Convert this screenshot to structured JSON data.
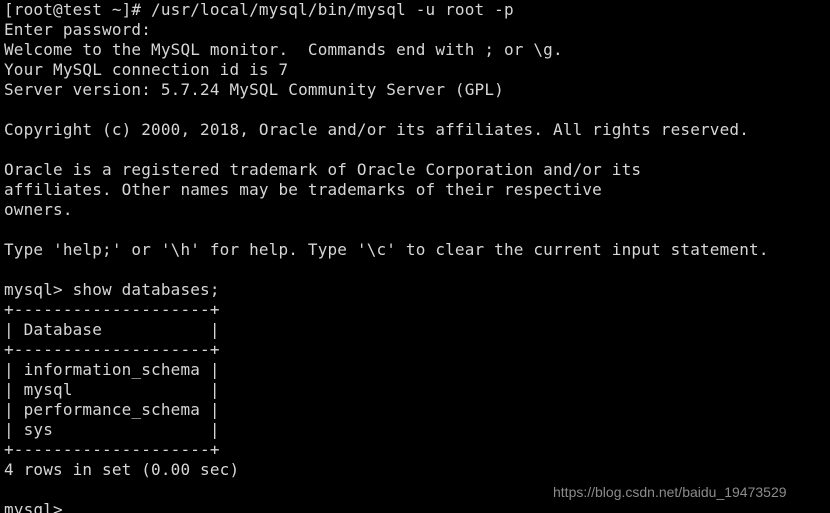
{
  "terminal": {
    "background_color": "#000000",
    "text_color": "#d6d6d6",
    "lines": [
      "[root@test ~]# /usr/local/mysql/bin/mysql -u root -p",
      "Enter password:",
      "Welcome to the MySQL monitor.  Commands end with ; or \\g.",
      "Your MySQL connection id is 7",
      "Server version: 5.7.24 MySQL Community Server (GPL)",
      "",
      "Copyright (c) 2000, 2018, Oracle and/or its affiliates. All rights reserved.",
      "",
      "Oracle is a registered trademark of Oracle Corporation and/or its",
      "affiliates. Other names may be trademarks of their respective",
      "owners.",
      "",
      "Type 'help;' or '\\h' for help. Type '\\c' to clear the current input statement.",
      "",
      "mysql> show databases;",
      "+--------------------+",
      "| Database           |",
      "+--------------------+",
      "| information_schema |",
      "| mysql              |",
      "| performance_schema |",
      "| sys                |",
      "+--------------------+",
      "4 rows in set (0.00 sec)",
      "",
      "mysql> "
    ],
    "prompt": {
      "shell_prompt": "[root@test ~]#",
      "mysql_prompt": "mysql>",
      "command_entered": "/usr/local/mysql/bin/mysql -u root -p",
      "sql_entered": "show databases;"
    },
    "session": {
      "password_prompt": "Enter password:",
      "welcome": "Welcome to the MySQL monitor.  Commands end with ; or \\g.",
      "connection_id_line": "Your MySQL connection id is 7",
      "connection_id": "7",
      "server_version_line": "Server version: 5.7.24 MySQL Community Server (GPL)",
      "server_version": "5.7.24",
      "server_edition": "MySQL Community Server (GPL)",
      "copyright": "Copyright (c) 2000, 2018, Oracle and/or its affiliates. All rights reserved.",
      "trademark_line_1": "Oracle is a registered trademark of Oracle Corporation and/or its",
      "trademark_line_2": "affiliates. Other names may be trademarks of their respective",
      "trademark_line_3": "owners.",
      "help_hint": "Type 'help;' or '\\h' for help. Type '\\c' to clear the current input statement."
    },
    "result_table": {
      "separator": "+--------------------+",
      "header_row": "| Database           |",
      "column_header": "Database",
      "rows": [
        "| information_schema |",
        "| mysql              |",
        "| performance_schema |",
        "| sys                |"
      ],
      "values": [
        "information_schema",
        "mysql",
        "performance_schema",
        "sys"
      ],
      "summary": "4 rows in set (0.00 sec)",
      "row_count": "4",
      "elapsed": "0.00 sec"
    }
  },
  "watermark": {
    "text": "https://blog.csdn.net/baidu_19473529",
    "color": "#8c8c8c"
  }
}
